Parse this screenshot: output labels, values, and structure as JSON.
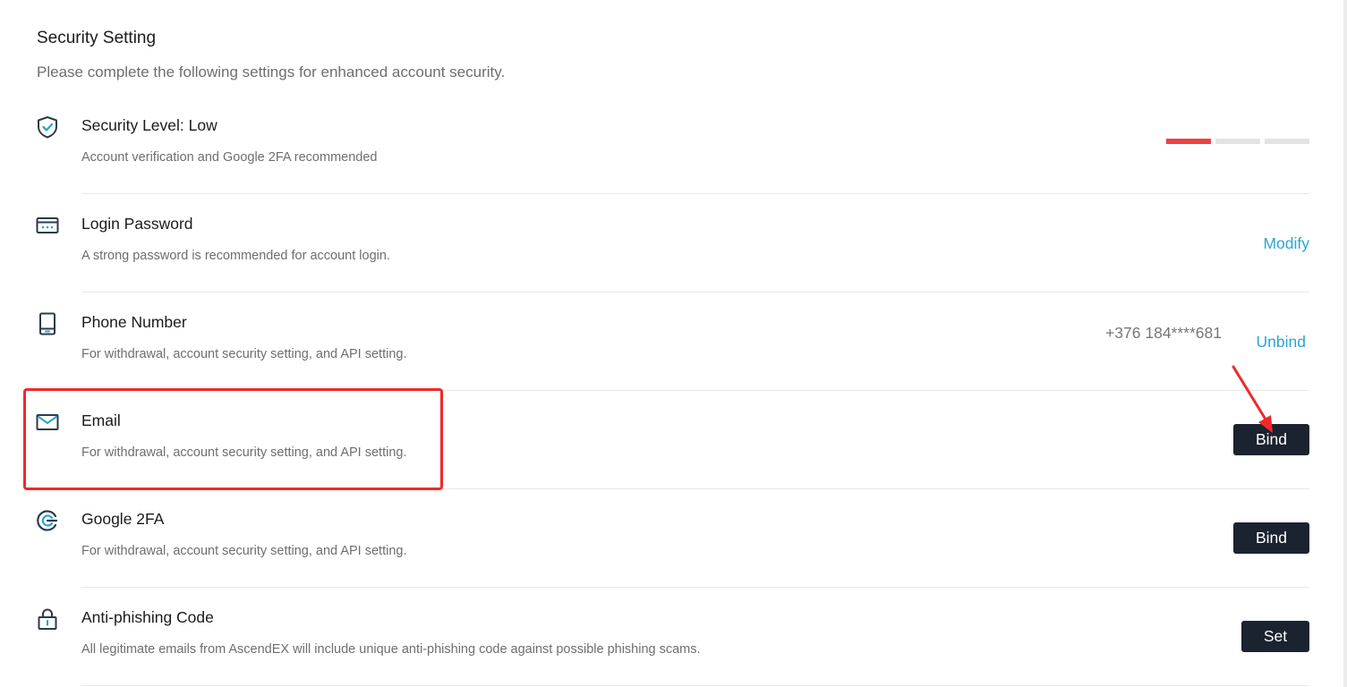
{
  "header": {
    "title": "Security Setting",
    "subtitle": "Please complete the following settings for enhanced account security."
  },
  "colors": {
    "accent_link": "#2ca5cf",
    "button_bg": "#1b2331",
    "level_active": "#ec4141",
    "level_inactive": "#e3e3e3",
    "highlight": "#ee2a2a"
  },
  "security_level": {
    "name": "Security Level: Low",
    "description": "Account verification and Google 2FA recommended",
    "icon": "shield-check-icon",
    "level": 1,
    "level_max": 3
  },
  "login_password": {
    "name": "Login Password",
    "description": "A strong password is recommended for account login.",
    "icon": "password-card-icon",
    "action": "Modify"
  },
  "phone": {
    "name": "Phone Number",
    "description": "For withdrawal, account security setting, and API setting.",
    "icon": "phone-icon",
    "value": "+376 184****681",
    "action": "Unbind"
  },
  "email": {
    "name": "Email",
    "description": "For withdrawal, account security setting, and API setting.",
    "icon": "envelope-icon",
    "action": "Bind"
  },
  "google_2fa": {
    "name": "Google 2FA",
    "description": "For withdrawal, account security setting, and API setting.",
    "icon": "google-authenticator-icon",
    "action": "Bind"
  },
  "anti_phishing": {
    "name": "Anti-phishing Code",
    "description": "All legitimate emails from AscendEX will include unique anti-phishing code against possible phishing scams.",
    "icon": "lock-icon",
    "action": "Set"
  }
}
